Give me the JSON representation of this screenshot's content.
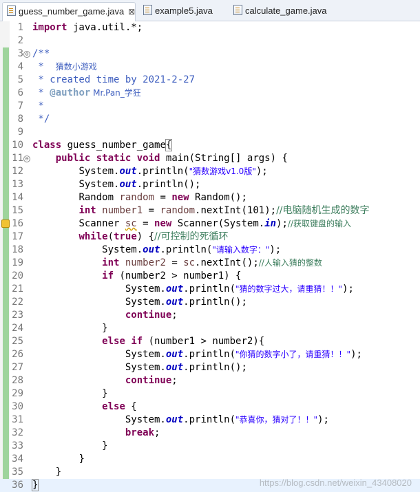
{
  "tabs": [
    {
      "label": "guess_number_game.java",
      "active": true,
      "close": "⊠"
    },
    {
      "label": "example5.java",
      "active": false
    },
    {
      "label": "calculate_game.java",
      "active": false
    }
  ],
  "editor": {
    "line_numbers": [
      "1",
      "2",
      "3",
      "4",
      "5",
      "6",
      "7",
      "8",
      "9",
      "10",
      "11",
      "12",
      "13",
      "14",
      "15",
      "16",
      "17",
      "18",
      "19",
      "20",
      "21",
      "22",
      "23",
      "24",
      "25",
      "26",
      "27",
      "28",
      "29",
      "30",
      "31",
      "32",
      "33",
      "34",
      "35",
      "36"
    ],
    "current_line": 36,
    "fold_marker": "⊖"
  },
  "code": {
    "l1_kw": "import",
    "l1_rest": " java.util.*;",
    "l3": "/**",
    "l4_star": " *  ",
    "l4_text": "猜数小游戏",
    "l5": " * created time by 2021-2-27",
    "l6_star": " * ",
    "l6_tag": "@author",
    "l6_text": " Mr.Pan_学狂",
    "l7": " *",
    "l8": " */",
    "l10_kw": "class",
    "l10_name": " guess_number_game",
    "l10_brace": "{",
    "kw_public": "public",
    "kw_static": "static",
    "kw_void": "void",
    "l11_rest": " main(String[] args) {",
    "sys": "System.",
    "out": "out",
    "println_open": ".println(",
    "println_empty": ".println();",
    "close_paren": ");",
    "l12_str": "\"猜数游戏v1.0版\"",
    "l14_a": "Random ",
    "l14_var": "random",
    "l14_b": " = ",
    "kw_new": "new",
    "l14_c": " Random();",
    "kw_int": "int",
    "l15_var": " number1",
    "l15_b": " = ",
    "l15_var2": "random",
    "l15_c": ".nextInt(101);",
    "l15_cm": "//电脑随机生成的数字",
    "l16_a": "Scanner ",
    "l16_var": "sc",
    "l16_b": " = ",
    "l16_c": " Scanner(System.",
    "l16_in": "in",
    "l16_d": ");",
    "l16_cm": "//获取键盘的输入",
    "kw_while": "while",
    "l17_b": "(",
    "kw_true": "true",
    "l17_c": ") {",
    "l17_cm": "//可控制的死循环",
    "l18_str": "\"请输入数字：\"",
    "l19_var": " number2",
    "l19_b": " = ",
    "l19_var2": "sc",
    "l19_c": ".nextInt();",
    "l19_cm": "//人输入猜的整数",
    "kw_if": "if",
    "l20_rest": " (number2 > number1) {",
    "l21_str": "\"猜的数字过大，请重猜！！\"",
    "kw_continue": "continue",
    "semi": ";",
    "rbrace": "}",
    "kw_else": "else",
    "l25_rest": " (number1 > number2){",
    "l26_str": "\"你猜的数字小了，请重猜！！\"",
    "l30_rest": " {",
    "l31_str": "\"恭喜你，猜对了！！\"",
    "kw_break": "break"
  },
  "watermark": "https://blog.csdn.net/weixin_43408020"
}
